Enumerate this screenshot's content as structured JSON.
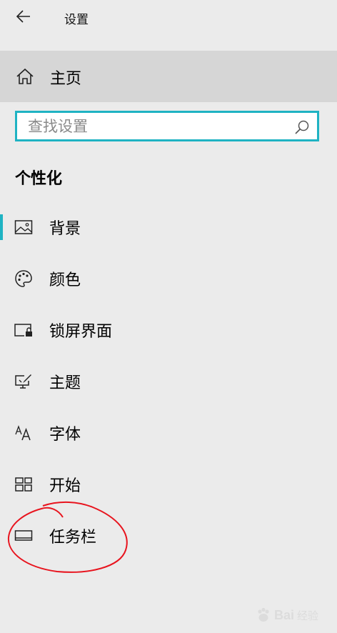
{
  "window": {
    "title": "设置"
  },
  "home": {
    "label": "主页",
    "icon": "home-icon"
  },
  "search": {
    "placeholder": "查找设置",
    "value": ""
  },
  "section": {
    "title": "个性化"
  },
  "nav": [
    {
      "id": "background",
      "label": "背景",
      "icon": "picture-icon",
      "selected": true
    },
    {
      "id": "colors",
      "label": "颜色",
      "icon": "palette-icon",
      "selected": false
    },
    {
      "id": "lockscreen",
      "label": "锁屏界面",
      "icon": "lock-screen-icon",
      "selected": false
    },
    {
      "id": "themes",
      "label": "主题",
      "icon": "theme-brush-icon",
      "selected": false
    },
    {
      "id": "fonts",
      "label": "字体",
      "icon": "font-icon",
      "selected": false
    },
    {
      "id": "start",
      "label": "开始",
      "icon": "start-tiles-icon",
      "selected": false
    },
    {
      "id": "taskbar",
      "label": "任务栏",
      "icon": "taskbar-icon",
      "selected": false
    }
  ],
  "colors": {
    "accent": "#1fb3c3",
    "home_highlight": "#d6d6d6",
    "background": "#ebebeb",
    "annotation": "#e8141e"
  },
  "watermark": {
    "brand": "Bai",
    "suffix": "经验",
    "icon": "baidu-paw-icon"
  }
}
